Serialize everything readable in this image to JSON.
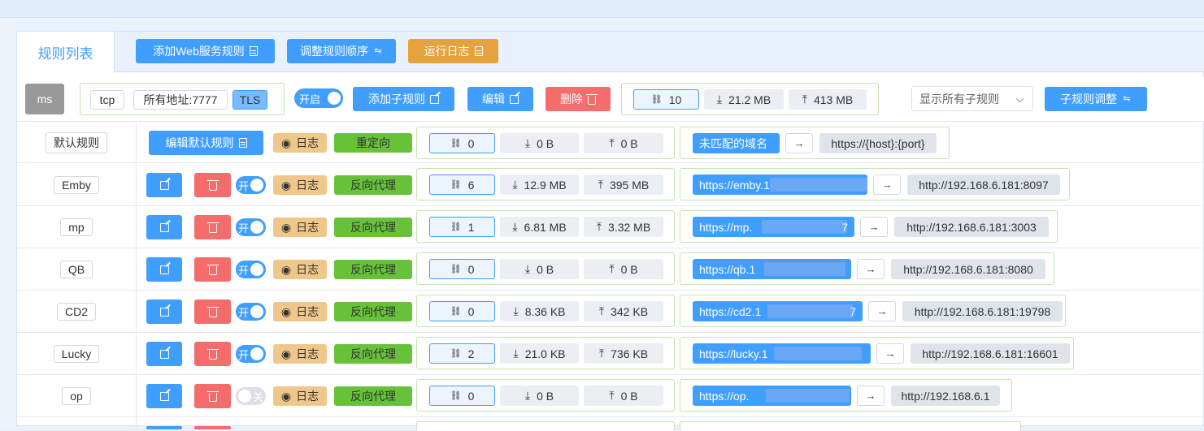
{
  "tabs": {
    "active": "规则列表"
  },
  "toolbar": {
    "add_web_rule": "添加Web服务规则",
    "reorder_rules": "调整规则顺序",
    "run_log": "运行日志"
  },
  "rule": {
    "name": "ms",
    "protocol": "tcp",
    "address": "所有地址:7777",
    "tls": "TLS",
    "enabled_label": "开启",
    "add_child": "添加子规则",
    "edit": "编辑",
    "delete": "删除",
    "conn_count": "10",
    "download": "21.2 MB",
    "upload": "413 MB",
    "filter_select": "显示所有子规则",
    "child_adjust": "子规则调整"
  },
  "default_row": {
    "name": "默认规则",
    "edit_default": "编辑默认规则",
    "log": "日志",
    "type": "重定向",
    "conn": "0",
    "download": "0 B",
    "upload": "0 B",
    "unmatched": "未匹配的域名",
    "arrow": "→",
    "target": "https://{host}:{port}"
  },
  "subrules": [
    {
      "name": "Emby",
      "toggle": "开",
      "enabled": true,
      "log": "日志",
      "type": "反向代理",
      "conn": "6",
      "download": "12.9 MB",
      "upload": "395 MB",
      "domain": "https://emby.1",
      "arrow": "→",
      "target": "http://192.168.6.181:8097"
    },
    {
      "name": "mp",
      "toggle": "开",
      "enabled": true,
      "log": "日志",
      "type": "反向代理",
      "conn": "1",
      "download": "6.81 MB",
      "upload": "3.32 MB",
      "domain": "https://mp.",
      "domain_tail": "7",
      "arrow": "→",
      "target": "http://192.168.6.181:3003"
    },
    {
      "name": "QB",
      "toggle": "开",
      "enabled": true,
      "log": "日志",
      "type": "反向代理",
      "conn": "0",
      "download": "0 B",
      "upload": "0 B",
      "domain": "https://qb.1",
      "arrow": "→",
      "target": "http://192.168.6.181:8080"
    },
    {
      "name": "CD2",
      "toggle": "开",
      "enabled": true,
      "log": "日志",
      "type": "反向代理",
      "conn": "0",
      "download": "8.36 KB",
      "upload": "342 KB",
      "domain": "https://cd2.1",
      "domain_tail": "7",
      "arrow": "→",
      "target": "http://192.168.6.181:19798"
    },
    {
      "name": "Lucky",
      "toggle": "开",
      "enabled": true,
      "log": "日志",
      "type": "反向代理",
      "conn": "2",
      "download": "21.0 KB",
      "upload": "736 KB",
      "domain": "https://lucky.1",
      "arrow": "→",
      "target": "http://192.168.6.181:16601"
    },
    {
      "name": "op",
      "toggle": "关",
      "enabled": false,
      "log": "日志",
      "type": "反向代理",
      "conn": "0",
      "download": "0 B",
      "upload": "0 B",
      "domain": "https://op.",
      "arrow": "→",
      "target": "http://192.168.6.1"
    }
  ],
  "colors": {
    "primary": "#409eff",
    "danger": "#f56c6c",
    "warning": "#e6a23c",
    "success": "#67c23a"
  }
}
